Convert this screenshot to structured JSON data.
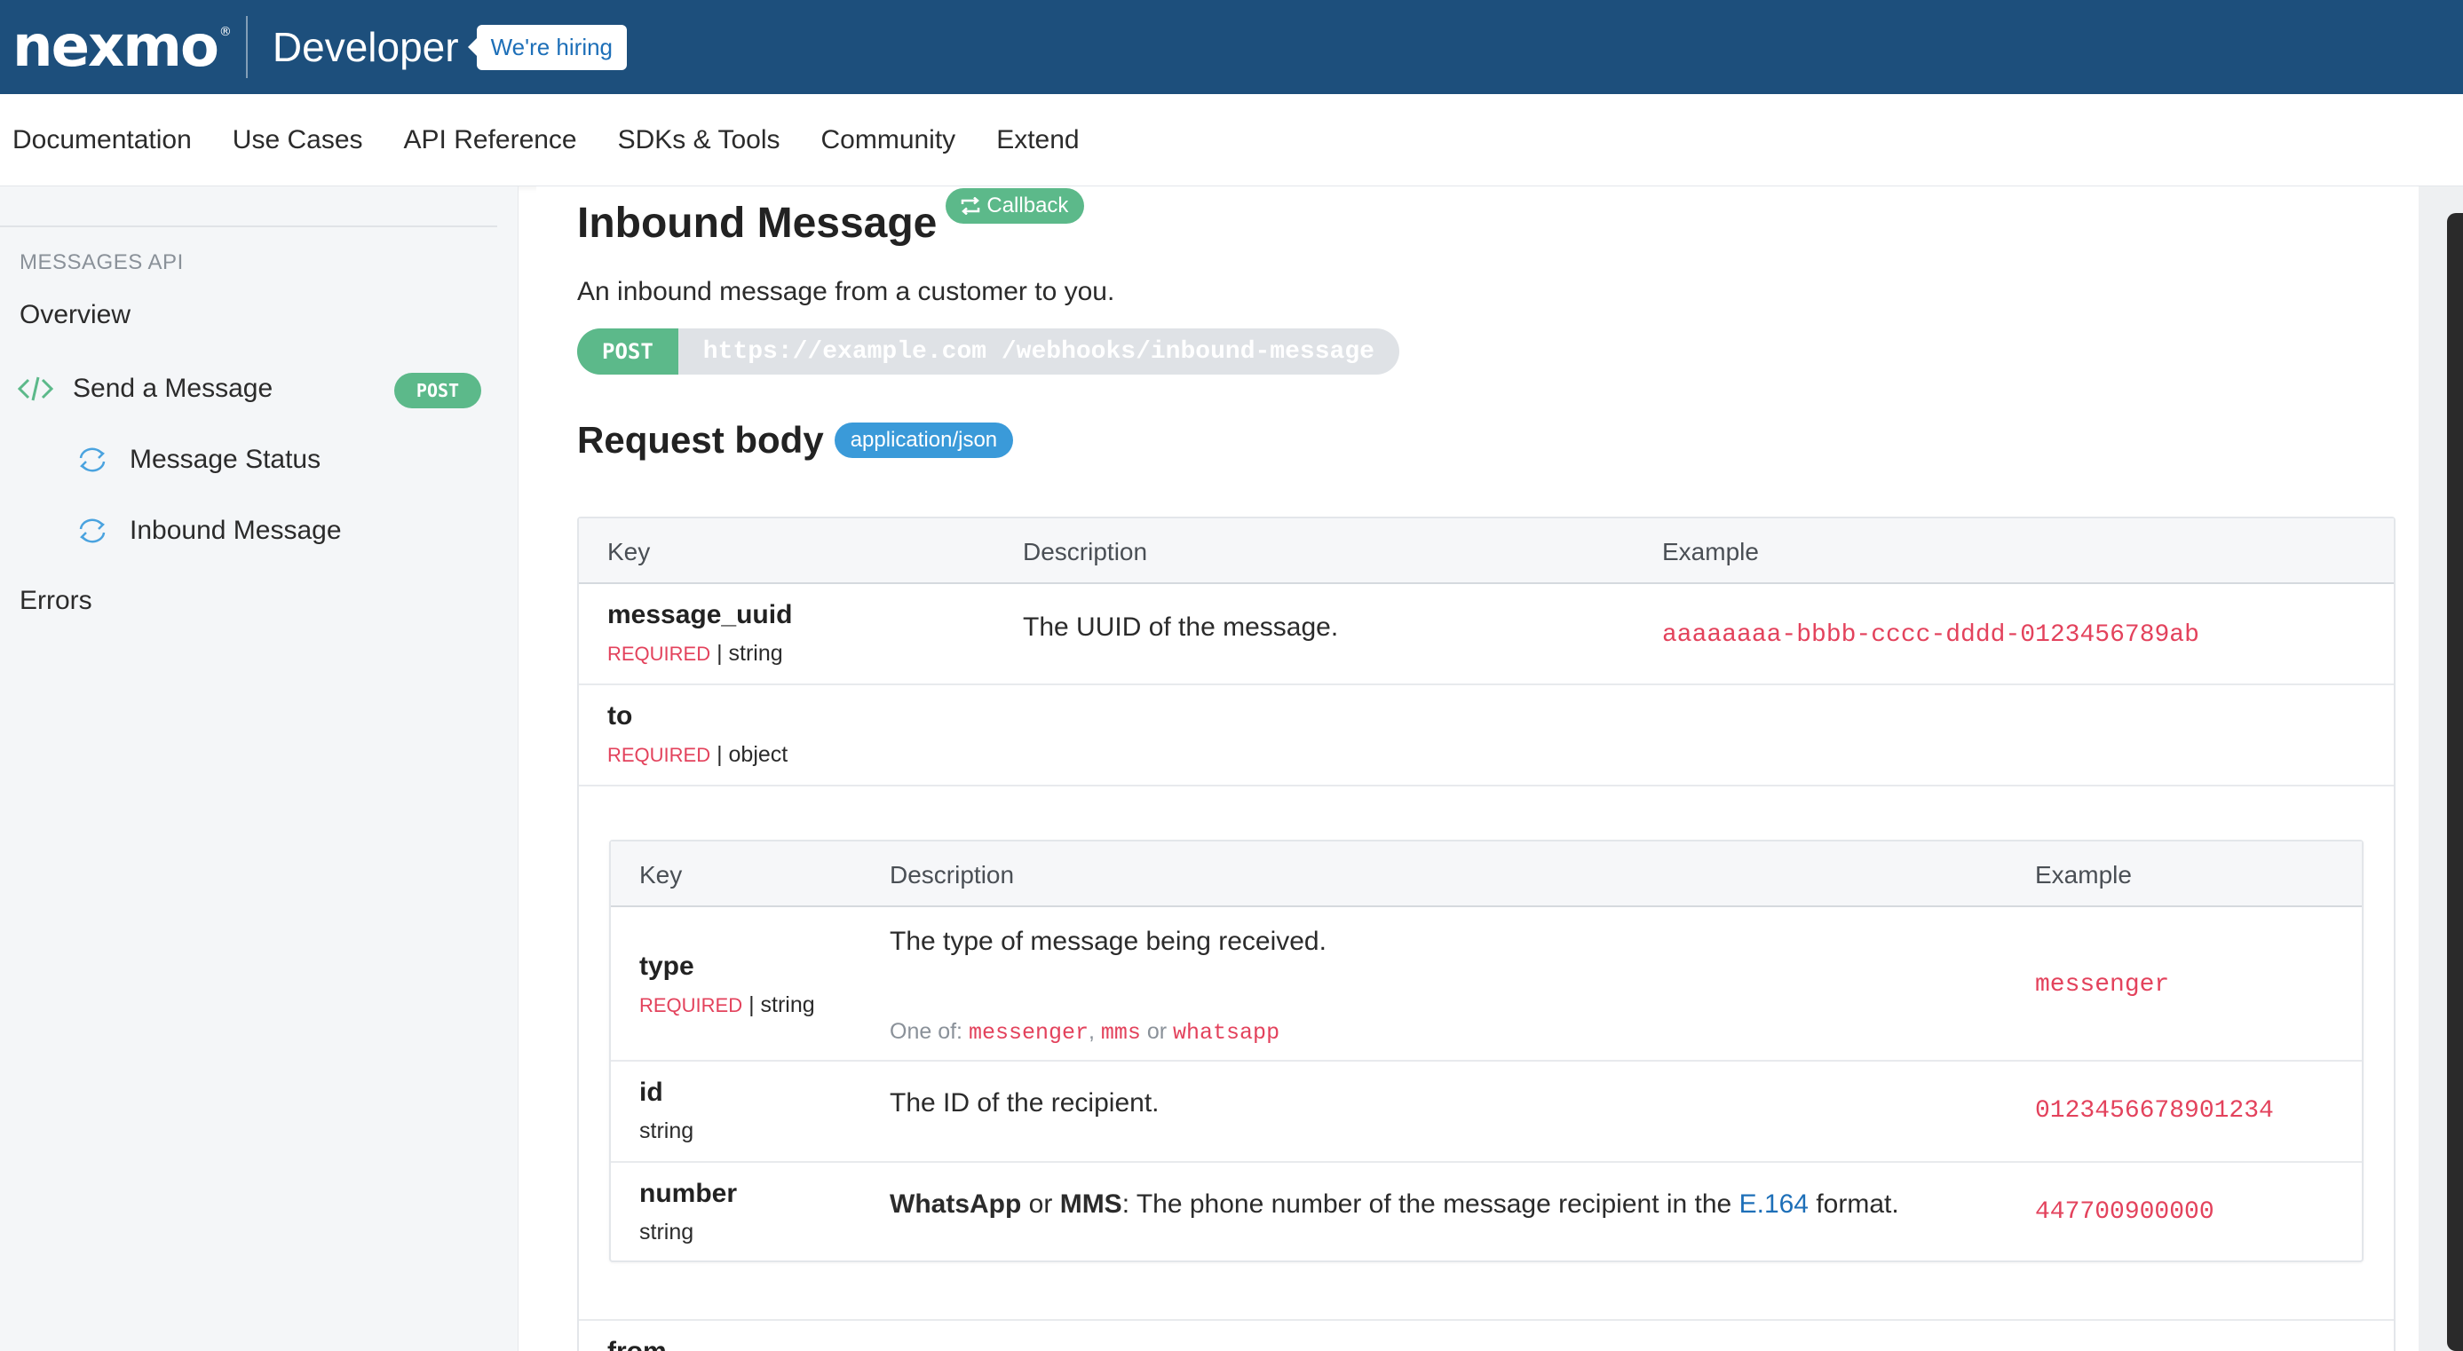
{
  "brand": {
    "logo_text": "nexmo",
    "logo_mark": "®",
    "product": "Developer",
    "hiring_badge": "We're hiring"
  },
  "nav": {
    "items": [
      "Documentation",
      "Use Cases",
      "API Reference",
      "SDKs & Tools",
      "Community",
      "Extend"
    ]
  },
  "sidebar": {
    "section_title": "MESSAGES API",
    "items": [
      {
        "label": "Overview",
        "icon": "none"
      },
      {
        "label": "Send a Message",
        "icon": "code-icon",
        "badge": "POST"
      },
      {
        "label": "Message Status",
        "icon": "callback-icon"
      },
      {
        "label": "Inbound Message",
        "icon": "callback-icon"
      },
      {
        "label": "Errors",
        "icon": "none"
      }
    ]
  },
  "main": {
    "title": "Inbound Message",
    "callback_badge": "Callback",
    "description": "An inbound message from a customer to you.",
    "endpoint": {
      "method": "POST",
      "url": "https://example.com /webhooks/inbound-message"
    },
    "request_body_title": "Request body",
    "content_type": "application/json",
    "table": {
      "headers": [
        "Key",
        "Description",
        "Example"
      ],
      "rows": [
        {
          "key": "message_uuid",
          "required": "REQUIRED",
          "type": "| string",
          "description": "The UUID of the message.",
          "example": "aaaaaaaa-bbbb-cccc-dddd-0123456789ab"
        },
        {
          "key": "to",
          "required": "REQUIRED",
          "type": "| object"
        }
      ],
      "partial_row_key": "from"
    },
    "inner_table": {
      "headers": [
        "Key",
        "Description",
        "Example"
      ],
      "rows": [
        {
          "key": "type",
          "required": "REQUIRED",
          "type": "| string",
          "description": "The type of message being received.",
          "one_of_label": "One of:",
          "one_of": [
            "messenger",
            "mms",
            "whatsapp"
          ],
          "one_of_sep1": ",",
          "one_of_sep2": "or",
          "example": "messenger"
        },
        {
          "key": "id",
          "type": "string",
          "description": "The ID of the recipient.",
          "example": "0123456678901234"
        },
        {
          "key": "number",
          "type": "string",
          "desc_bold1": "WhatsApp",
          "desc_or": "or",
          "desc_bold2": "MMS",
          "desc_text": ": The phone number of the message recipient in the",
          "desc_link": "E.164",
          "desc_end": "format.",
          "example": "447700900000"
        }
      ]
    }
  },
  "colors": {
    "brand_blue": "#1d4f7c",
    "green": "#5cb98a",
    "json_blue": "#3a9ad9",
    "code_red": "#e3425c",
    "link_blue": "#1d6fb8"
  }
}
